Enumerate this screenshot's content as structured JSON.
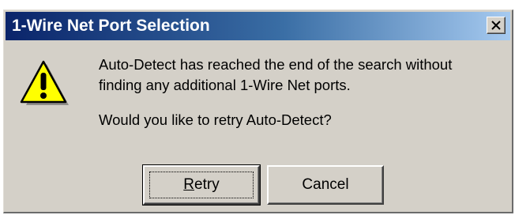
{
  "window": {
    "title": "1-Wire Net Port Selection",
    "close_icon": "close-icon"
  },
  "message": {
    "icon": "warning-icon",
    "line1": "Auto-Detect has reached the end of the search without",
    "line2": "finding any additional 1-Wire Net ports.",
    "question": "Would you like to retry Auto-Detect?"
  },
  "buttons": {
    "retry": {
      "label_mnemonic": "R",
      "label_rest": "etry",
      "default": true
    },
    "cancel": {
      "label": "Cancel"
    }
  },
  "colors": {
    "titlebar_start": "#0a246a",
    "titlebar_end": "#a6caf0",
    "dialog_face": "#d4d0c8",
    "warning_fill": "#ffff00"
  }
}
